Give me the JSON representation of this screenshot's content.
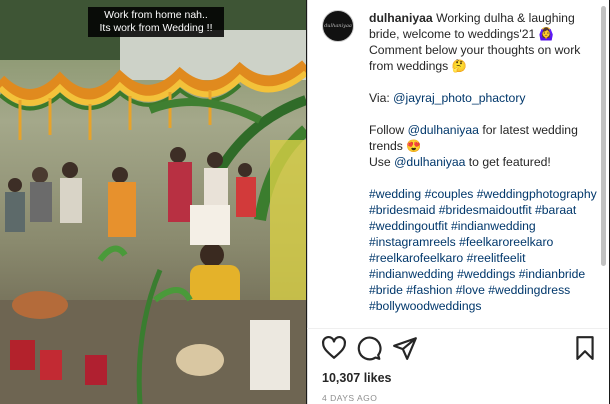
{
  "media": {
    "overlay_line1": "Work from home nah..",
    "overlay_line2": "Its work from Wedding !!"
  },
  "post": {
    "username": "dulhaniyaa",
    "caption_intro": "Working dulha & laughing bride, welcome to weddings'21 🙆‍♀️ Comment below your thoughts on work from weddings 🤔",
    "via_label": "Via: ",
    "via_handle": "@jayraj_photo_phactory",
    "follow_prefix": "Follow ",
    "follow_handle": "@dulhaniyaa",
    "follow_suffix": " for latest wedding trends 😍",
    "use_prefix": "Use ",
    "use_handle": "@dulhaniyaa",
    "use_suffix": " to get featured!",
    "hashtags": [
      "#wedding",
      "#couples",
      "#weddingphotography",
      "#bridesmaid",
      "#bridesmaidoutfit",
      "#baraat",
      "#weddingoutfit",
      "#indianwedding",
      "#instagramreels",
      "#feelkaroreelkaro",
      "#reelkarofeelkaro",
      "#reelitfeelit",
      "#indianwedding",
      "#weddings",
      "#indianbride",
      "#bride",
      "#fashion",
      "#love",
      "#weddingdress",
      "#bollywoodweddings"
    ]
  },
  "footer": {
    "likes": "10,307 likes",
    "time": "4 DAYS AGO"
  },
  "icons": {
    "like": "heart-icon",
    "comment": "comment-icon",
    "share": "paper-plane-icon",
    "save": "bookmark-icon"
  }
}
